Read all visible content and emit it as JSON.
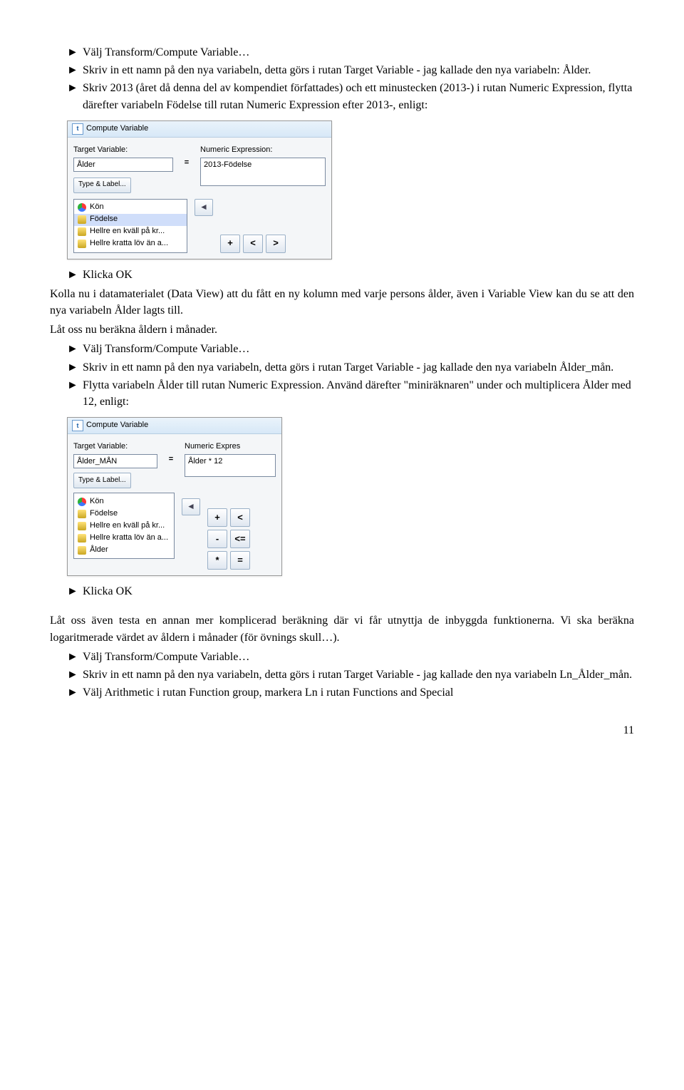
{
  "bullets_top": [
    "Välj Transform/Compute Variable…",
    "Skriv in ett namn på den nya variabeln, detta görs i rutan Target Variable - jag kallade den nya variabeln: Ålder.",
    "Skriv 2013 (året då denna del av kompendiet författades) och ett minustecken (2013-) i rutan Numeric Expression, flytta därefter variabeln Födelse till rutan Numeric Expression efter 2013-, enligt:"
  ],
  "dlg1": {
    "title": "Compute Variable",
    "target_lbl": "Target Variable:",
    "target_val": "Ålder",
    "numeric_lbl": "Numeric Expression:",
    "numeric_val": "2013-Födelse",
    "type_btn": "Type & Label...",
    "vars": [
      {
        "name": "Kön",
        "cls": "nominal3"
      },
      {
        "name": "Födelse",
        "cls": "scale",
        "sel": true
      },
      {
        "name": "Hellre en kväll på kr...",
        "cls": "scale"
      },
      {
        "name": "Hellre kratta löv än a...",
        "cls": "scale"
      }
    ],
    "arrow_glyph": "◄",
    "keys": [
      "+",
      "<",
      ">"
    ]
  },
  "after_dlg1_bullet": "Klicka OK",
  "mid_paras": [
    "Kolla nu i datamaterialet (Data View) att du fått en ny kolumn med varje persons ålder, även i Variable View kan du se att den nya variabeln Ålder lagts till.",
    "Låt oss nu beräkna åldern i månader."
  ],
  "bullets_mid": [
    "Välj Transform/Compute Variable…",
    "Skriv in ett namn på den nya variabeln, detta görs i rutan Target Variable - jag kallade den nya variabeln Ålder_mån.",
    "Flytta variabeln Ålder till rutan Numeric Expression. Använd därefter \"miniräknaren\" under och multiplicera Ålder med 12, enligt:"
  ],
  "dlg2": {
    "title": "Compute Variable",
    "target_lbl": "Target Variable:",
    "target_val": "Ålder_MÅN",
    "numeric_lbl": "Numeric Expres",
    "numeric_val": "Ålder * 12",
    "type_btn": "Type & Label...",
    "vars": [
      {
        "name": "Kön",
        "cls": "nominal3"
      },
      {
        "name": "Födelse",
        "cls": "scale"
      },
      {
        "name": "Hellre en kväll på kr...",
        "cls": "scale"
      },
      {
        "name": "Hellre kratta löv än a...",
        "cls": "scale"
      },
      {
        "name": "Ålder",
        "cls": "scale"
      }
    ],
    "arrow_glyph": "◄",
    "keypad": [
      [
        "+",
        "<"
      ],
      [
        "-",
        "<="
      ],
      [
        "*",
        "="
      ]
    ]
  },
  "after_dlg2_bullet": "Klicka OK",
  "end_paras": [
    "Låt oss även testa en annan mer komplicerad beräkning där vi får utnyttja de inbyggda funktionerna. Vi ska beräkna logaritmerade värdet av åldern i månader (för övnings skull…)."
  ],
  "bullets_end": [
    "Välj Transform/Compute Variable…",
    "Skriv in ett namn på den nya variabeln, detta görs i rutan Target Variable - jag kallade den nya variabeln Ln_Ålder_mån.",
    "Välj Arithmetic i rutan Function group, markera Ln i rutan Functions and Special"
  ],
  "page_number": "11"
}
